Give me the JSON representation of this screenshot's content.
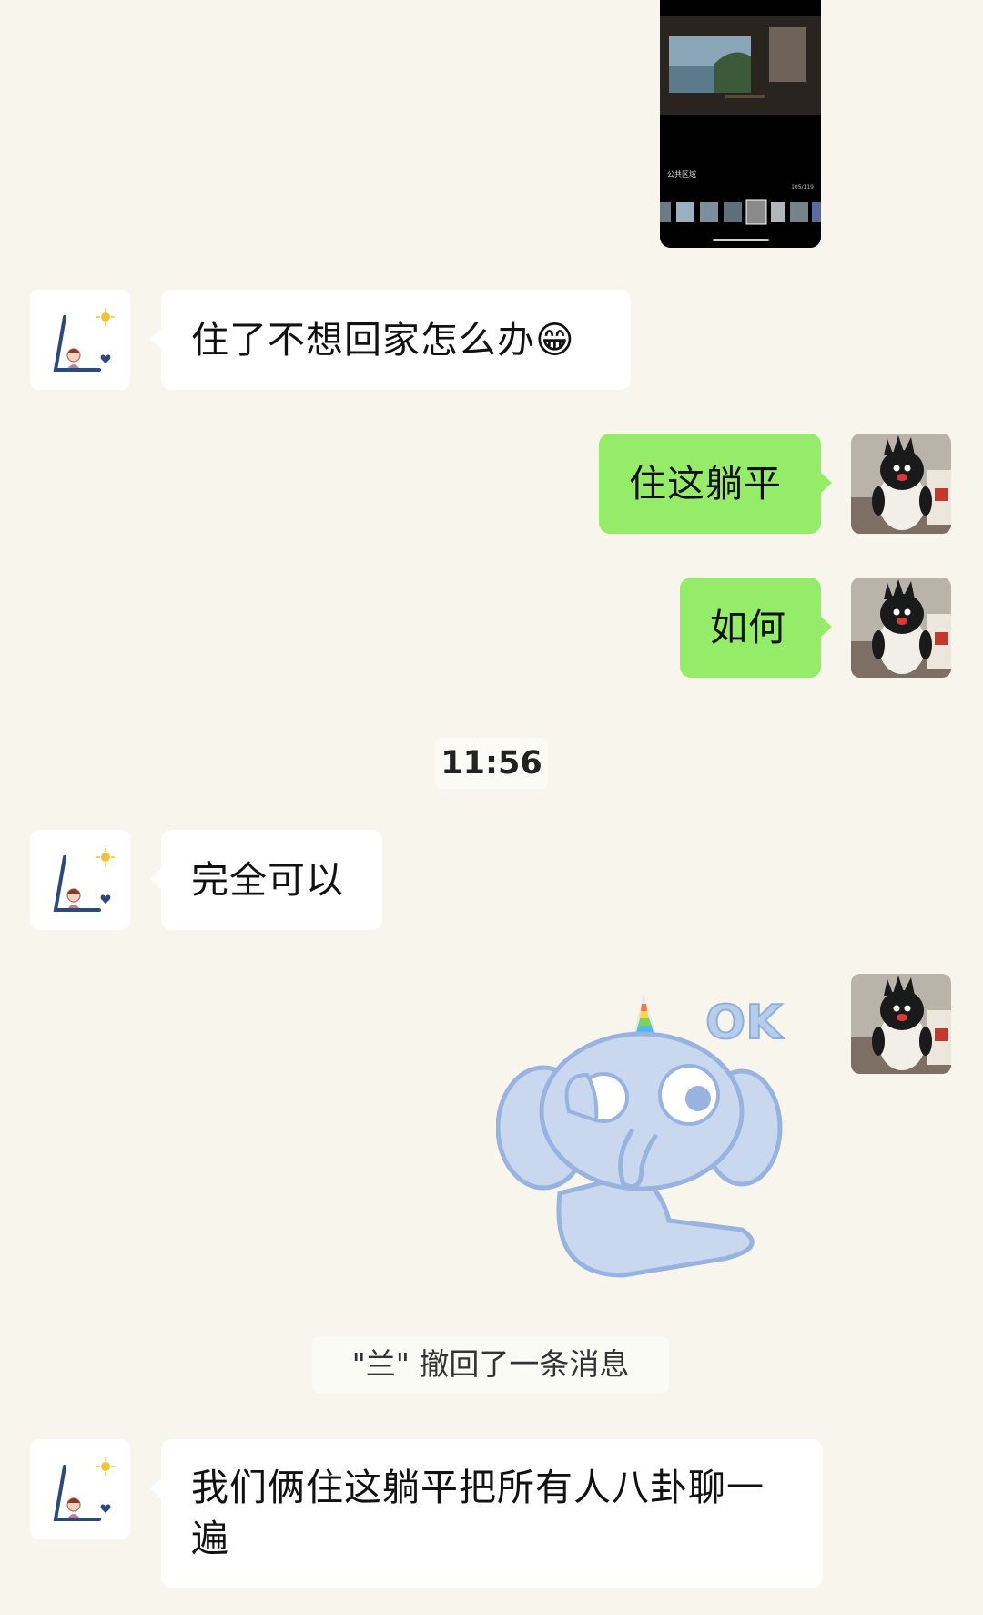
{
  "shared_image": {
    "caption": "公共区域",
    "counter": "105/119"
  },
  "messages": [
    {
      "side": "left",
      "text": "住了不想回家怎么办😁"
    },
    {
      "side": "right",
      "text": "住这躺平"
    },
    {
      "side": "right",
      "text": "如何"
    },
    {
      "side": "left",
      "text": "完全可以"
    },
    {
      "side": "right",
      "text": "",
      "sticker_text": "OK"
    },
    {
      "side": "left",
      "text": "我们俩住这躺平把所有人八卦聊一遍"
    }
  ],
  "timestamp": "11:56",
  "recall_notice": "\"兰\" 撤回了一条消息",
  "colors": {
    "background": "#f8f6ec",
    "self_bubble": "#95ec69",
    "other_bubble": "#ffffff"
  }
}
